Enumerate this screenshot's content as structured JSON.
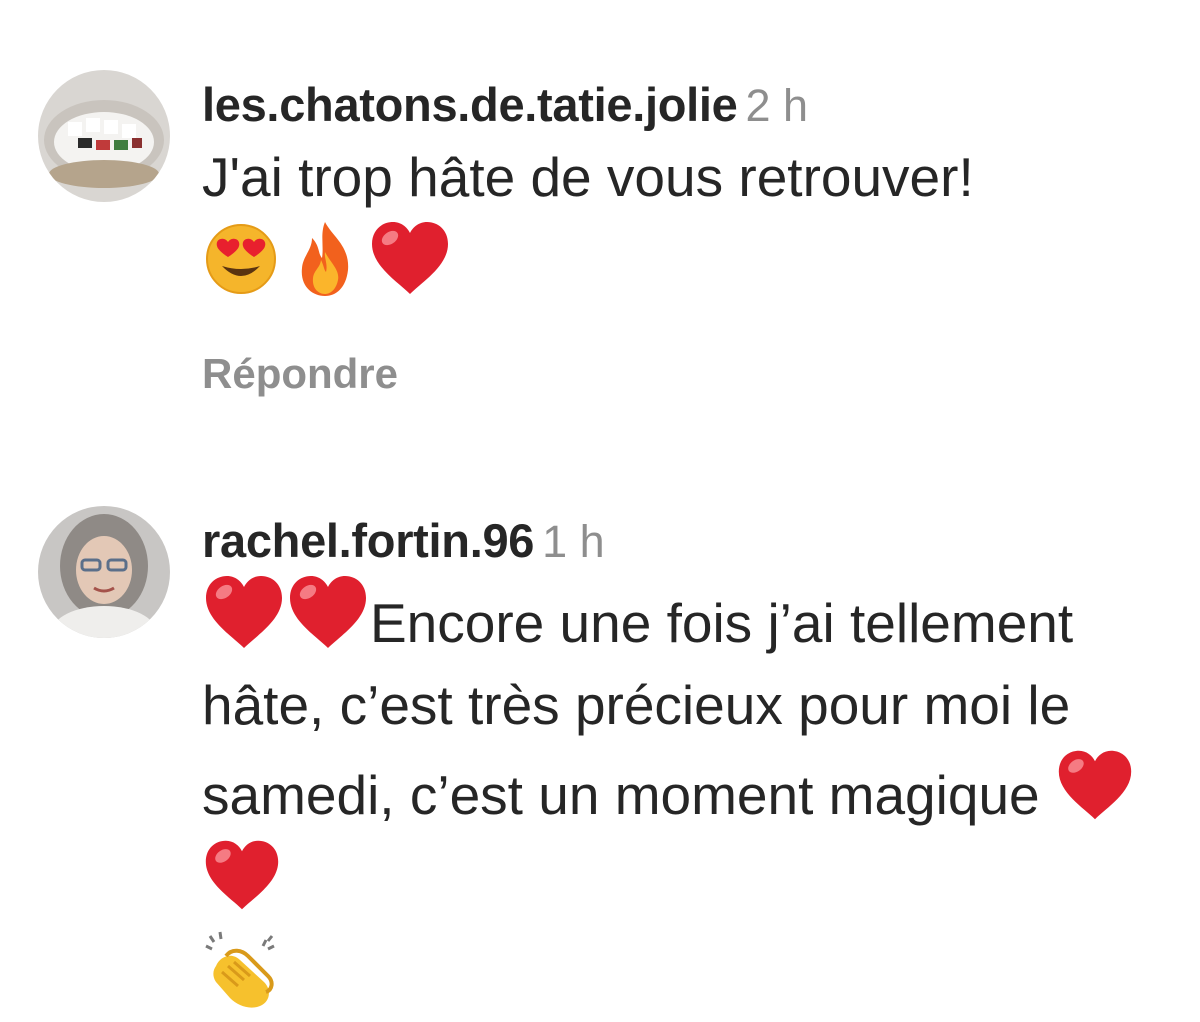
{
  "comments": [
    {
      "username": "les.chatons.de.tatie.jolie",
      "time": "2 h",
      "text": "J'ai trop hâte de vous retrouver!",
      "emojis": [
        "heart-eyes-emoji",
        "fire-emoji",
        "red-heart-emoji"
      ],
      "reply_label": "Répondre"
    },
    {
      "username": "rachel.fortin.96",
      "time": "1 h",
      "text": "Encore une fois j’ai tellement hâte, c’est très précieux pour moi le samedi, c’est un moment magique",
      "leading_emojis": [
        "red-heart-emoji",
        "red-heart-emoji"
      ],
      "trailing_emojis": [
        "red-heart-emoji",
        "red-heart-emoji",
        "clapping-hands-emoji"
      ]
    }
  ],
  "colors": {
    "text": "#262626",
    "secondary": "#8e8e8e",
    "heart": "#e0202e"
  }
}
